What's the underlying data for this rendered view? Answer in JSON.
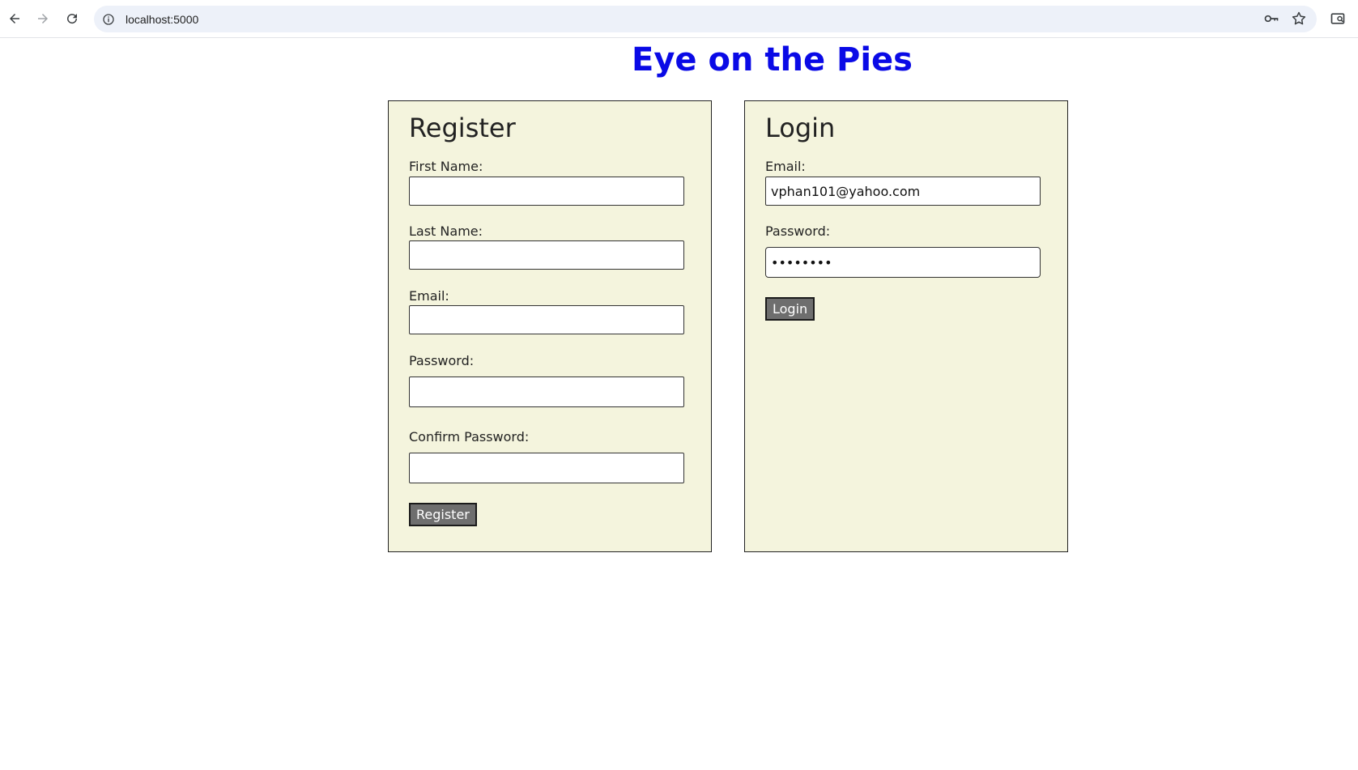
{
  "browser": {
    "url": "localhost:5000",
    "icons": [
      "back-icon",
      "forward-icon",
      "reload-icon",
      "site-info-icon",
      "password-key-icon",
      "bookmark-star-icon",
      "side-panel-icon"
    ]
  },
  "page": {
    "title": "Eye on the Pies",
    "title_color": "#0a0ae6",
    "panel_color": "#f4f4dd"
  },
  "register": {
    "heading": "Register",
    "first_name_label": "First Name:",
    "first_name_value": "",
    "last_name_label": "Last Name:",
    "last_name_value": "",
    "email_label": "Email:",
    "email_value": "",
    "password_label": "Password:",
    "password_value": "",
    "confirm_password_label": "Confirm Password:",
    "confirm_password_value": "",
    "button_label": "Register"
  },
  "login": {
    "heading": "Login",
    "email_label": "Email:",
    "email_value": "vphan101@yahoo.com",
    "password_label": "Password:",
    "password_value": "••••••••",
    "button_label": "Login"
  }
}
